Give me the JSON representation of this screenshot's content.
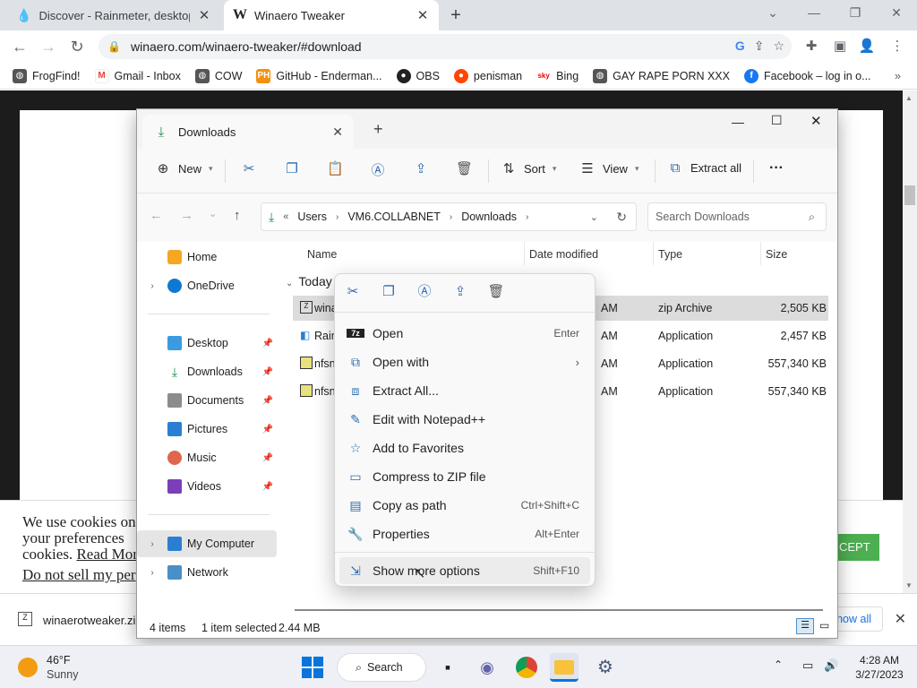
{
  "browser": {
    "tabs": [
      {
        "title": "Discover - Rainmeter, desktop cu",
        "active": false
      },
      {
        "title": "Winaero Tweaker",
        "active": true
      }
    ],
    "url": "winaero.com/winaero-tweaker/#download",
    "bookmarks": [
      "FrogFind!",
      "Gmail - Inbox",
      "COW",
      "GitHub - Enderman...",
      "OBS",
      "penisman",
      "Bing",
      "GAY RAPE PORN XXX",
      "Facebook – log in o..."
    ]
  },
  "page": {
    "cookie_line1": "We use cookies on",
    "cookie_line2": "your preferences",
    "cookie_line3a": "cookies.",
    "cookie_line3b": "Read More",
    "cookie_line4": "Do not sell my per",
    "accept_label": "CEPT",
    "download_file": "winaerotweaker.zi",
    "show_all": "Show all"
  },
  "explorer": {
    "tab_title": "Downloads",
    "cmd": {
      "new": "New",
      "sort": "Sort",
      "view": "View",
      "extract_all": "Extract all"
    },
    "breadcrumb": [
      "Users",
      "VM6.COLLABNET",
      "Downloads"
    ],
    "search_placeholder": "Search Downloads",
    "nav": {
      "home": "Home",
      "onedrive": "OneDrive",
      "desktop": "Desktop",
      "downloads": "Downloads",
      "documents": "Documents",
      "pictures": "Pictures",
      "music": "Music",
      "videos": "Videos",
      "mycomputer": "My Computer",
      "network": "Network"
    },
    "columns": {
      "name": "Name",
      "date": "Date modified",
      "type": "Type",
      "size": "Size"
    },
    "group": "Today",
    "files": [
      {
        "name": "wina",
        "date": "AM",
        "type": "zip Archive",
        "size": "2,505 KB"
      },
      {
        "name": "Rain",
        "date": "AM",
        "type": "Application",
        "size": "2,457 KB"
      },
      {
        "name": "nfsn",
        "date": "AM",
        "type": "Application",
        "size": "557,340 KB"
      },
      {
        "name": "nfsn",
        "date": "AM",
        "type": "Application",
        "size": "557,340 KB"
      }
    ],
    "status": {
      "items": "4 items",
      "selected": "1 item selected",
      "size": "2.44 MB"
    }
  },
  "context_menu": {
    "items": [
      {
        "label": "Open",
        "shortcut": "Enter"
      },
      {
        "label": "Open with",
        "shortcut": ""
      },
      {
        "label": "Extract All...",
        "shortcut": ""
      },
      {
        "label": "Edit with Notepad++",
        "shortcut": ""
      },
      {
        "label": "Add to Favorites",
        "shortcut": ""
      },
      {
        "label": "Compress to ZIP file",
        "shortcut": ""
      },
      {
        "label": "Copy as path",
        "shortcut": "Ctrl+Shift+C"
      },
      {
        "label": "Properties",
        "shortcut": "Alt+Enter"
      },
      {
        "label": "Show more options",
        "shortcut": "Shift+F10"
      }
    ]
  },
  "taskbar": {
    "weather_temp": "46°F",
    "weather_desc": "Sunny",
    "search_label": "Search",
    "time": "4:28 AM",
    "date": "3/27/2023"
  }
}
